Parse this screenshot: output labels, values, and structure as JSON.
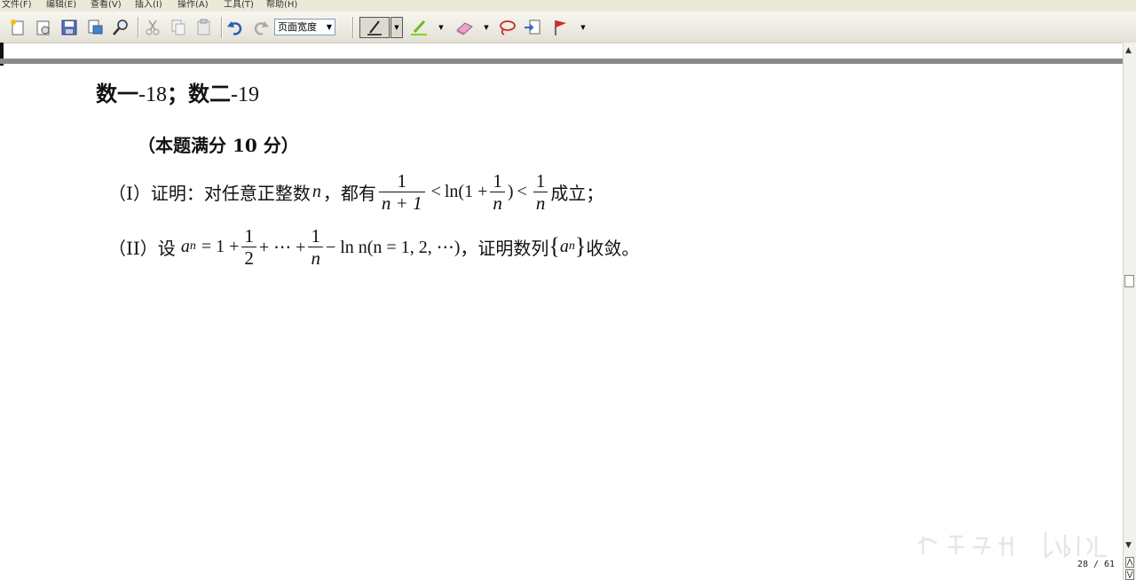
{
  "menu": [
    "文件(F)",
    "编辑(E)",
    "查看(V)",
    "插入(I)",
    "操作(A)",
    "工具(T)",
    "帮助(H)"
  ],
  "toolbar": {
    "icons": [
      "new-icon",
      "properties-icon",
      "save-icon",
      "print-icon",
      "find-icon",
      "cut-icon",
      "copy-icon",
      "paste-icon",
      "undo-icon",
      "redo-icon"
    ],
    "zoom_value": "页面宽度",
    "pen_tools": [
      "pen-icon",
      "highlighter-icon",
      "eraser-icon",
      "lasso-icon",
      "insert-space-icon",
      "flag-icon"
    ]
  },
  "doc": {
    "heading_a": "数一",
    "heading_a_num": "-18",
    "heading_sep": "；",
    "heading_b": "数二",
    "heading_b_num": "-19",
    "score": "（本题满分 10 分）",
    "p1": {
      "label": "（I）证明：对任意正整数",
      "var": "n",
      "mid": "，都有",
      "f1_num": "1",
      "f1_den": "n + 1",
      "lt1": "<",
      "ln_open": "ln(1 +",
      "f2_num": "1",
      "f2_den": "n",
      "ln_close": ")",
      "lt2": "<",
      "f3_num": "1",
      "f3_den": "n",
      "end": "成立；"
    },
    "p2": {
      "label": "（II）设",
      "a": "a",
      "sub": "n",
      "eq": "= 1 +",
      "f1_num": "1",
      "f1_den": "2",
      "dots": "+ ⋯ +",
      "f2_num": "1",
      "f2_den": "n",
      "tail": "− ln n(n = 1, 2, ⋯)",
      "mid": "，证明数列",
      "brace_l": "{",
      "seq_a": "a",
      "seq_sub": "n",
      "brace_r": "}",
      "end": "收敛。"
    }
  },
  "status": {
    "page_indicator": "28 / 61"
  }
}
